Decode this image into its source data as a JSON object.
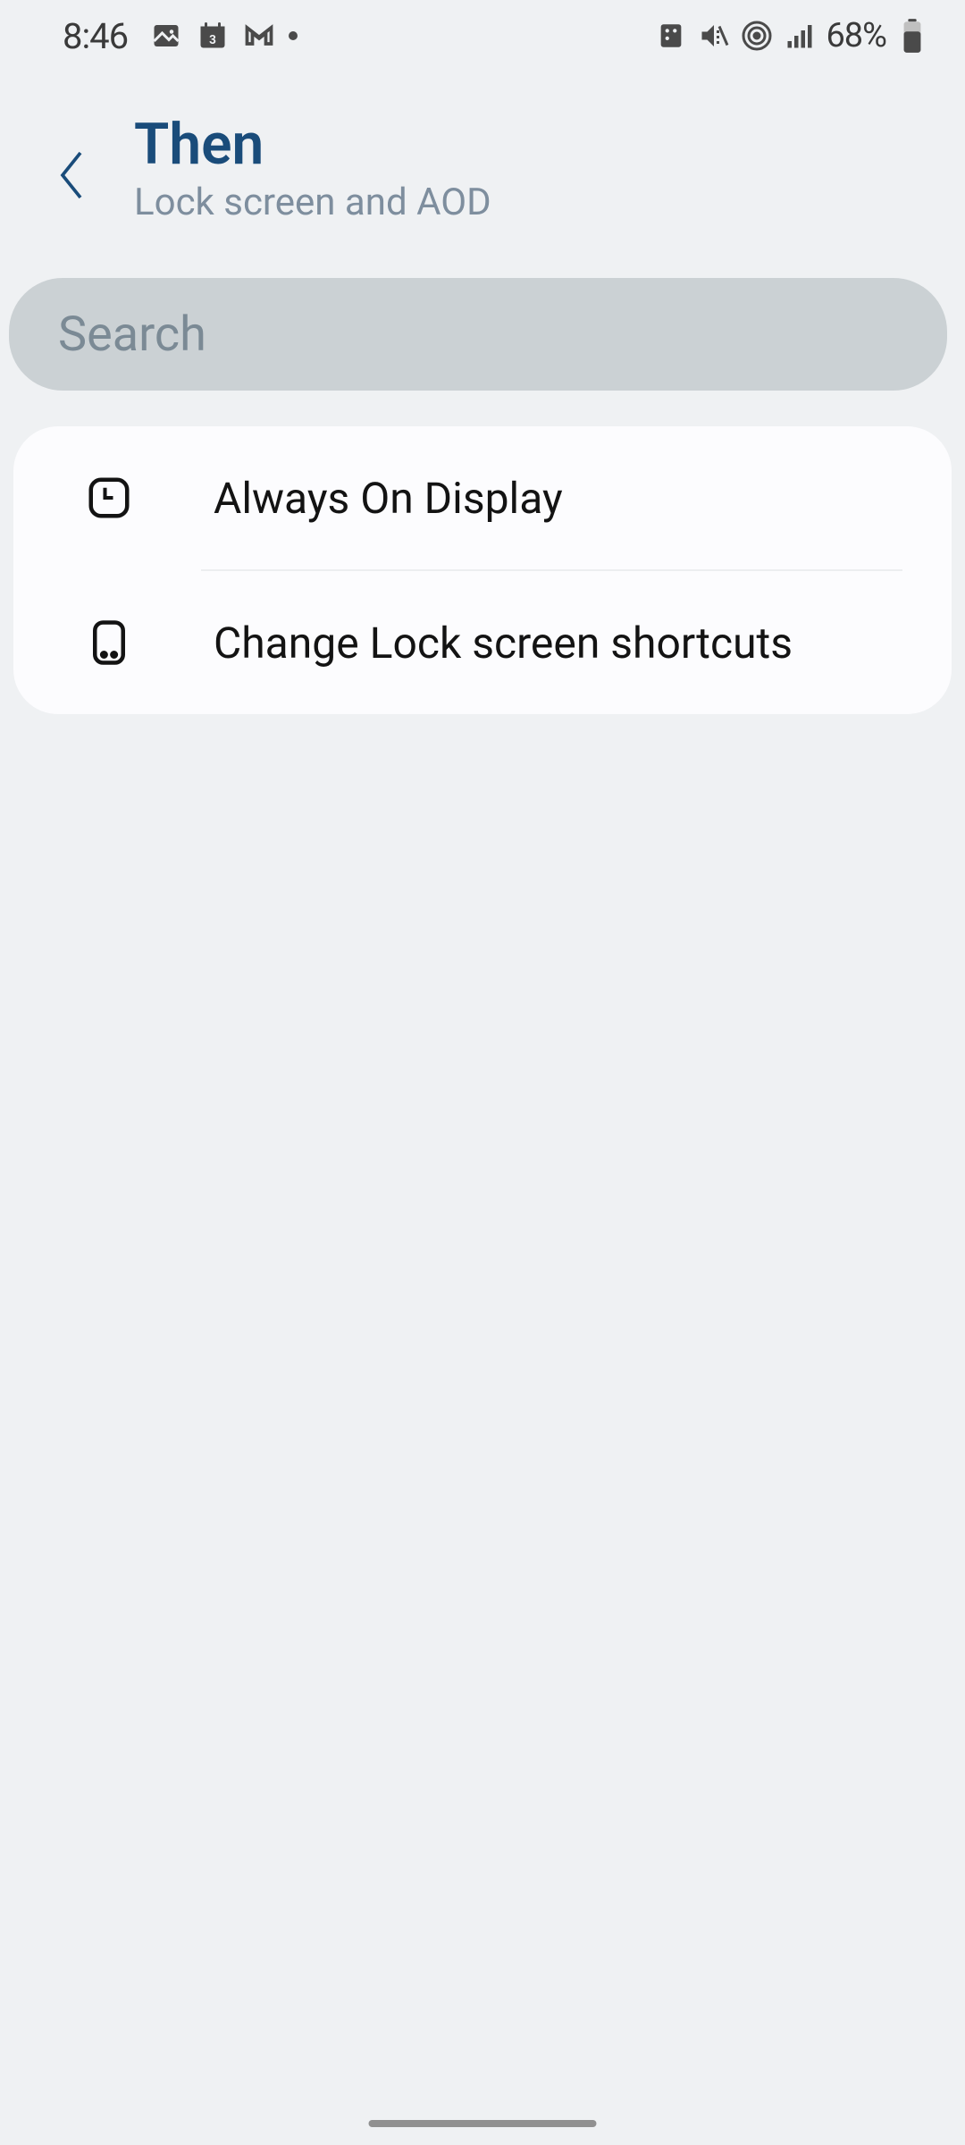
{
  "status_bar": {
    "time": "8:46",
    "left_icons": [
      "gallery-icon",
      "calendar-icon",
      "gmail-icon",
      "dot-icon"
    ],
    "right_icons": [
      "smartthings-icon",
      "mute-icon",
      "hotspot-icon",
      "signal-icon"
    ],
    "battery_text": "68%"
  },
  "header": {
    "title": "Then",
    "subtitle": "Lock screen and AOD"
  },
  "search": {
    "placeholder": "Search"
  },
  "list": {
    "items": [
      {
        "label": "Always On Display",
        "icon_name": "aod-icon"
      },
      {
        "label": "Change Lock screen shortcuts",
        "icon_name": "phone-shortcut-icon"
      }
    ]
  }
}
